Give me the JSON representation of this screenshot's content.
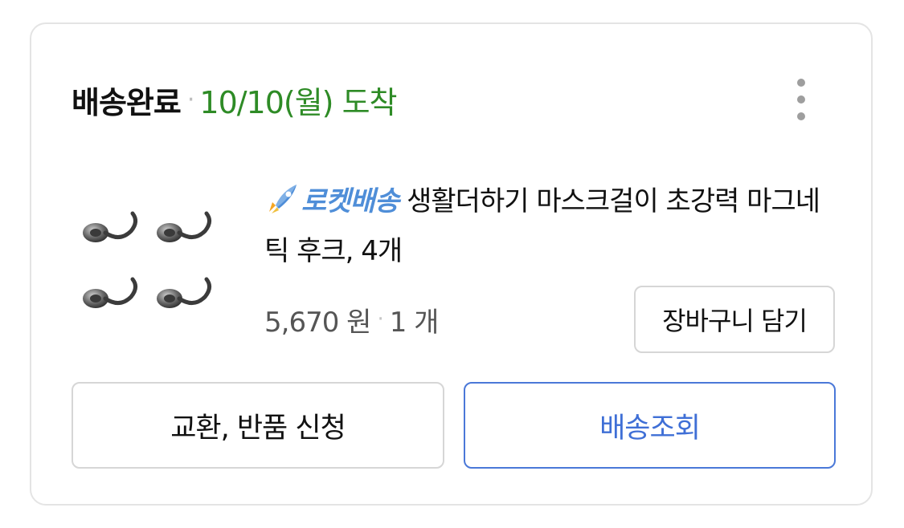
{
  "order": {
    "status": "배송완료",
    "separator": "·",
    "arrival": "10/10(월) 도착",
    "more_icon": "more-vertical-icon",
    "status_color": "#2e8b26"
  },
  "product": {
    "thumbnail_icon": "magnetic-hooks-image",
    "badge_icon": "rocket-icon",
    "badge_label": "로켓배송",
    "badge_color": "#4f8ed8",
    "name": "생활더하기 마스크걸이 초강력 마그네틱 후크, 4개",
    "price": "5,670 원",
    "separator": "·",
    "quantity": "1 개",
    "cart_button": "장바구니 담기"
  },
  "actions": {
    "exchange_label": "교환, 반품 신청",
    "tracking_label": "배송조회",
    "tracking_color": "#3f6fd6"
  }
}
